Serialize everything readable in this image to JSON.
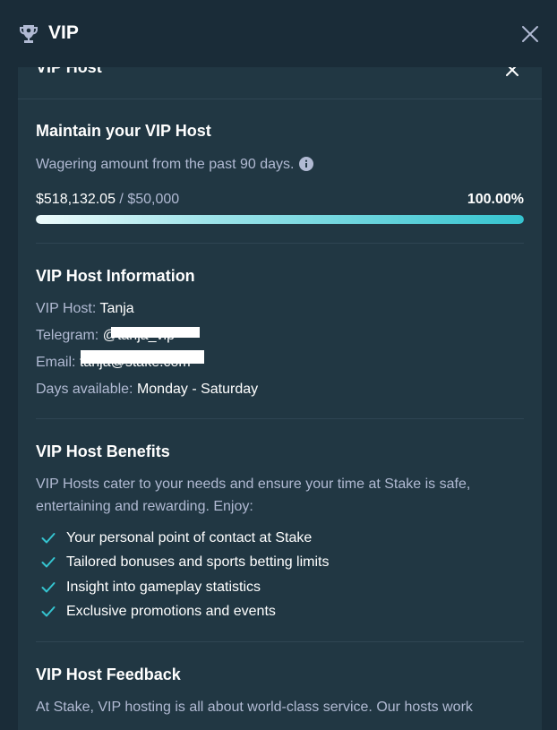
{
  "header": {
    "title": "VIP",
    "trophy_icon": "trophy-icon",
    "close_icon": "close-icon"
  },
  "panel": {
    "title": "VIP Host",
    "collapse_icon": "close-icon"
  },
  "maintain": {
    "heading": "Maintain your VIP Host",
    "subtitle": "Wagering amount from the past 90 days.",
    "info_icon": "info-icon",
    "current": "$518,132.05",
    "separator": " / ",
    "target": "$50,000",
    "percent_text": "100.00%",
    "progress_fraction": 1.0
  },
  "info": {
    "heading": "VIP Host Information",
    "host_label": "VIP Host:",
    "host_value": "Tanja",
    "telegram_label": "Telegram:",
    "telegram_value": "@tanja_vip",
    "email_label": "Email:",
    "email_value": "tanja@stake.com",
    "days_label": "Days available:",
    "days_value": "Monday - Saturday"
  },
  "benefits": {
    "heading": "VIP Host Benefits",
    "intro_line1": "VIP Hosts cater to your needs and ensure your time at Stake is safe,",
    "intro_line2": "entertaining and rewarding. Enjoy:",
    "items": [
      "Your personal point of contact at Stake",
      "Tailored bonuses and sports betting limits",
      "Insight into gameplay statistics",
      "Exclusive promotions and events"
    ]
  },
  "feedback": {
    "heading": "VIP Host Feedback",
    "text": "At Stake, VIP hosting is all about world-class service. Our hosts work"
  },
  "colors": {
    "background": "#1a2c38",
    "panel": "#213743",
    "accent": "#35c4d0",
    "muted_text": "#b1bad3"
  }
}
